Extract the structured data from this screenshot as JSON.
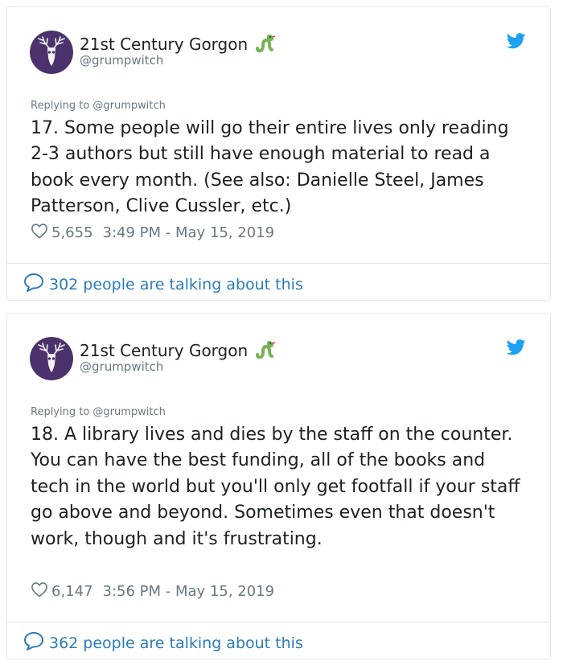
{
  "colors": {
    "link": "#2b7bb9",
    "muted": "#697882",
    "text": "#1c2022",
    "twitter_blue": "#1da1f2",
    "border": "#e1e8ed"
  },
  "tweets": [
    {
      "display_name": "21st Century Gorgon",
      "name_emoji": "snake-icon",
      "handle": "@grumpwitch",
      "replying_to": "Replying to @grumpwitch",
      "text": "17. Some people will go their entire lives only reading 2-3 authors but still have enough material to read a book every month. (See also: Danielle Steel, James Patterson, Clive Cussler, etc.)",
      "likes": "5,655",
      "timestamp": "3:49 PM - May 15, 2019",
      "talking": "302 people are talking about this"
    },
    {
      "display_name": "21st Century Gorgon",
      "name_emoji": "snake-icon",
      "handle": "@grumpwitch",
      "replying_to": "Replying to @grumpwitch",
      "text": "18. A library lives and dies by the staff on the counter. You can have the best funding, all of the books and tech in the world but you'll only get footfall if your staff go above and beyond. Sometimes even that doesn't work, though and it's frustrating.",
      "likes": "6,147",
      "timestamp": "3:56 PM - May 15, 2019",
      "talking": "362 people are talking about this"
    }
  ]
}
